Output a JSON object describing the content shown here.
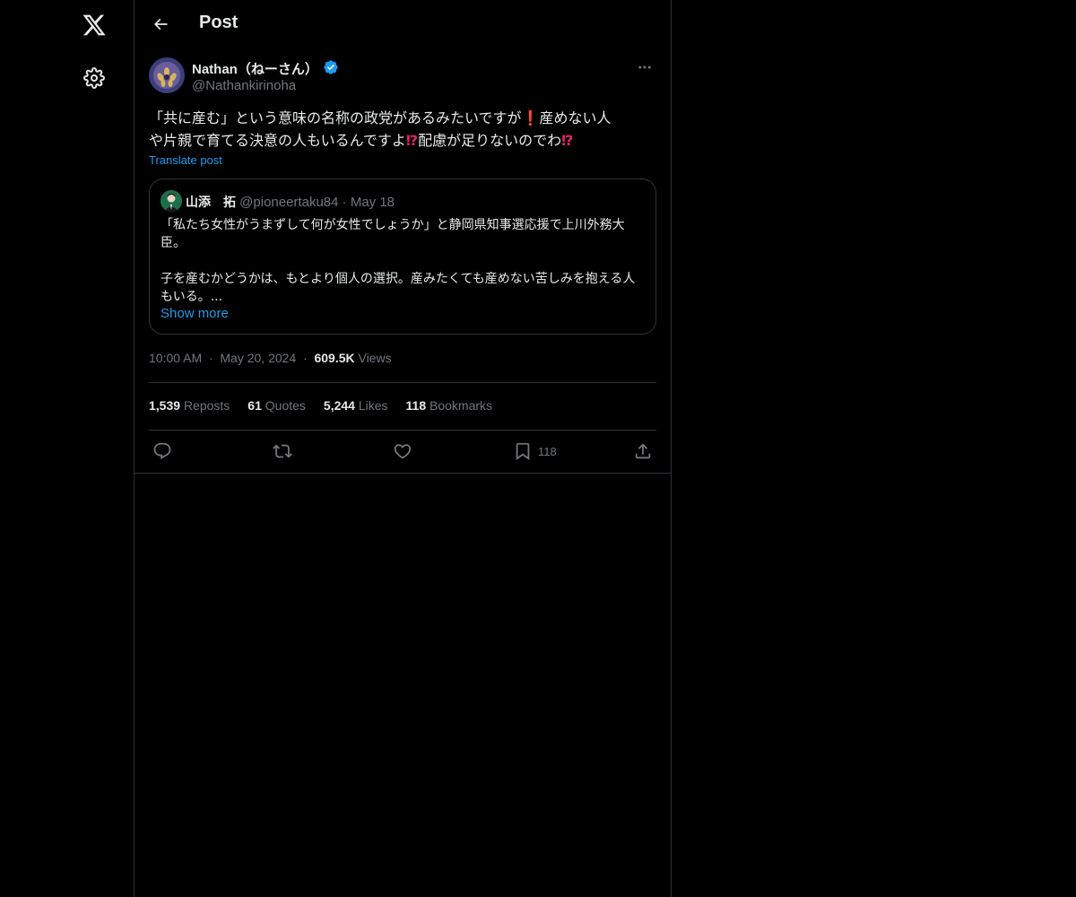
{
  "nav": {
    "logo_icon": "x-logo-icon",
    "settings_icon": "gear-icon"
  },
  "header": {
    "title": "Post"
  },
  "post": {
    "author_name": "Nathan（ねーさん）",
    "author_handle": "@Nathankirinoha",
    "text_line1_a": "「共に産む」という意味の名称の政党があるみたいですが",
    "emoji1": "❗",
    "text_line1_b": "産めない人",
    "text_line2_a": "や片親で育てる決意の人もいるんですよ",
    "emoji2": "⁉",
    "text_line2_b": "配慮が足りないのでわ",
    "emoji3": "⁉",
    "translate_label": "Translate post",
    "timestamp": "10:00 AM",
    "date": "May 20, 2024",
    "views_count": "609.5K",
    "views_label": "Views"
  },
  "quote": {
    "name": "山添　拓",
    "handle": "@pioneertaku84",
    "date": "May 18",
    "para1": "「私たち女性がうまずして何が女性でしょうか」と静岡県知事選応援で上川外務大臣。",
    "para2": "子を産むかどうかは、もとより個人の選択。産みたくても産めない苦しみを抱える人もいる。...",
    "show_more": "Show more"
  },
  "stats": {
    "reposts_count": "1,539",
    "reposts_label": "Reposts",
    "quotes_count": "61",
    "quotes_label": "Quotes",
    "likes_count": "5,244",
    "likes_label": "Likes",
    "bookmarks_count": "118",
    "bookmarks_label": "Bookmarks"
  },
  "actions": {
    "bookmark_count": "118"
  },
  "colors": {
    "background": "#000000",
    "text": "#e7e9ea",
    "muted": "#71767b",
    "accent": "#1d9bf0",
    "border": "#2f3336"
  }
}
